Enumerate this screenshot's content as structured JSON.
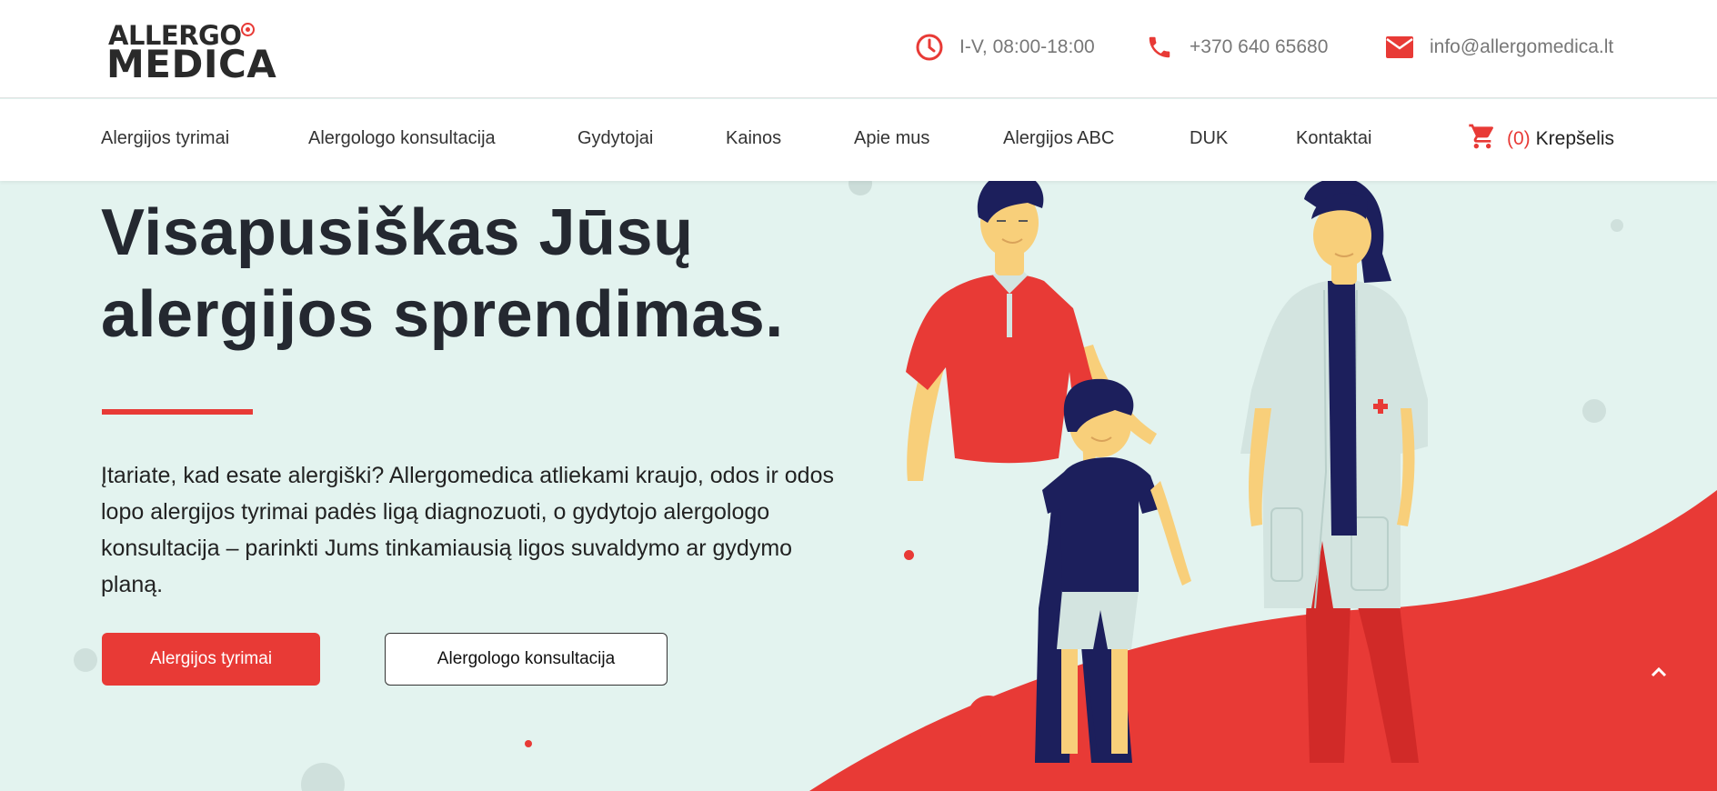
{
  "header": {
    "logo_line1": "ALLERGO",
    "logo_line2": "MEDICA",
    "hours": "I-V, 08:00-18:00",
    "phone": "+370 640 65680",
    "email": "info@allergomedica.lt",
    "icons": [
      "clock-icon",
      "phone-icon",
      "mail-icon"
    ]
  },
  "nav": {
    "items": [
      {
        "label": "Alergijos tyrimai"
      },
      {
        "label": "Alergologo konsultacija"
      },
      {
        "label": "Gydytojai"
      },
      {
        "label": "Kainos"
      },
      {
        "label": "Apie mus"
      },
      {
        "label": "Alergijos ABC"
      },
      {
        "label": "DUK"
      },
      {
        "label": "Kontaktai"
      }
    ],
    "cart": {
      "count": "(0)",
      "label": "Krepšelis",
      "icon": "cart-icon"
    }
  },
  "hero": {
    "title_line1": "Visapusiškas Jūsų",
    "title_line2": "alergijos sprendimas.",
    "text": "Įtariate, kad esate alergiški? Allergomedica atliekami kraujo, odos ir odos lopo alergijos tyrimai padės ligą diagnozuoti, o gydytojo alergologo konsultacija – parinkti Jums tinkamiausią ligos suvaldymo ar gydymo planą.",
    "primary_button": "Alergijos tyrimai",
    "secondary_button": "Alergologo konsultacija"
  },
  "colors": {
    "accent": "#e83a36",
    "background": "#e3f3ef",
    "navy": "#1c1f5c",
    "skin": "#f8cf7a",
    "coat": "#d3e4e0"
  }
}
